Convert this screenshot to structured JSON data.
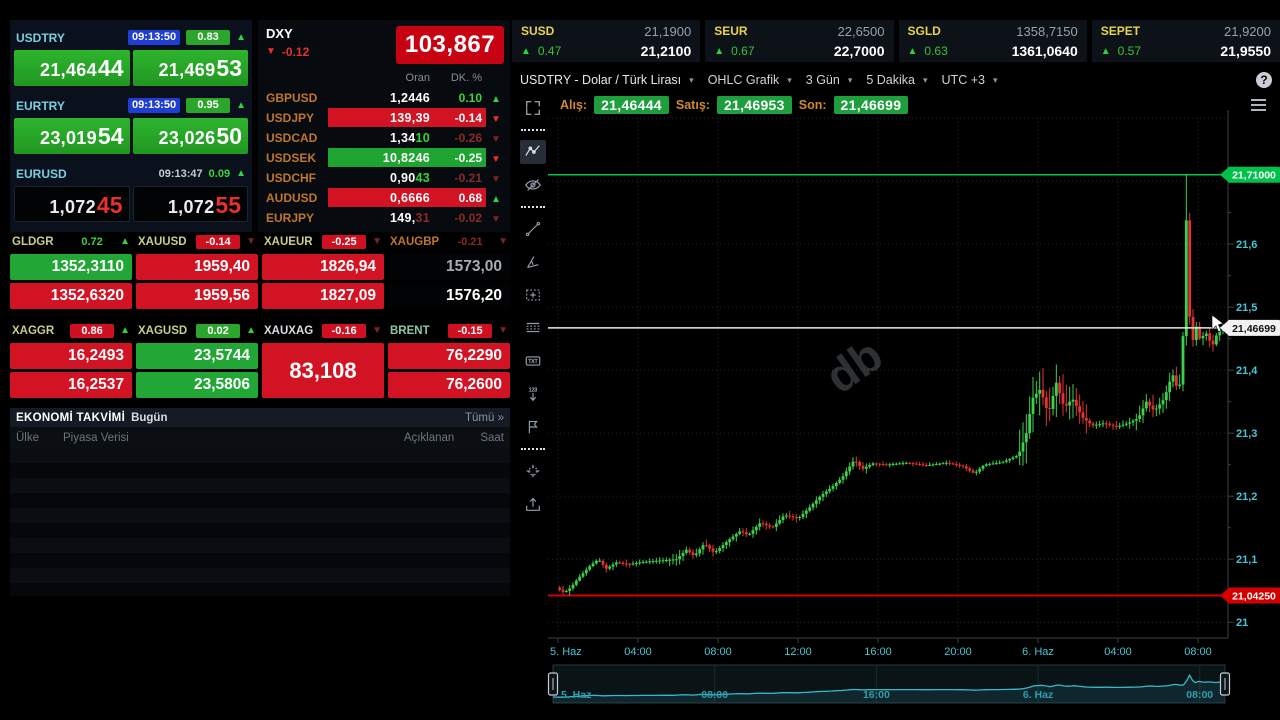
{
  "topbar": {
    "items": [
      {
        "label": "SUSD",
        "prev": "21,1900",
        "pct": "0.47",
        "value": "21,2100",
        "dir": "up"
      },
      {
        "label": "SEUR",
        "prev": "22,6500",
        "pct": "0.67",
        "value": "22,7000",
        "dir": "up"
      },
      {
        "label": "SGLD",
        "prev": "1358,7150",
        "pct": "0.63",
        "value": "1361,0640",
        "dir": "up"
      },
      {
        "label": "SEPET",
        "prev": "21,9200",
        "pct": "0.57",
        "value": "21,9550",
        "dir": "up"
      }
    ]
  },
  "quotes": [
    {
      "pair": "USDTRY",
      "time": "09:13:50",
      "time_badge": true,
      "pct": "0.83",
      "pct_badge": true,
      "dir": "up",
      "bid": [
        "21,464",
        "44"
      ],
      "ask": [
        "21,469",
        "53"
      ],
      "tile": "green"
    },
    {
      "pair": "EURTRY",
      "time": "09:13:50",
      "time_badge": true,
      "pct": "0.95",
      "pct_badge": true,
      "dir": "up",
      "bid": [
        "23,019",
        "54"
      ],
      "ask": [
        "23,026",
        "50"
      ],
      "tile": "green"
    },
    {
      "pair": "EURUSD",
      "time": "09:13:47",
      "time_badge": false,
      "pct": "0.09",
      "pct_badge": false,
      "dir": "up",
      "bid": [
        "1,072",
        "45"
      ],
      "ask": [
        "1,072",
        "55"
      ],
      "tile": "dark"
    }
  ],
  "dxy": {
    "label": "DXY",
    "pct": "-0.12",
    "dir": "down",
    "value": "103,867",
    "columns": {
      "rate": "Oran",
      "change": "DK. %"
    },
    "rows": [
      {
        "pair": "GBPUSD",
        "value": "1,2446",
        "hl": "",
        "hl_style": "",
        "pct": "0.10",
        "box": "none",
        "pct_color": "green",
        "arrow": "g"
      },
      {
        "pair": "USDJPY",
        "value": "139,39",
        "hl": "",
        "hl_style": "",
        "pct": "-0.14",
        "box": "red",
        "pct_color": "",
        "arrow": "r"
      },
      {
        "pair": "USDCAD",
        "value": "1,34",
        "hl": "10",
        "hl_style": "green",
        "pct": "-0.26",
        "box": "none",
        "pct_color": "dim",
        "arrow": "d"
      },
      {
        "pair": "USDSEK",
        "value": "10,8246",
        "hl": "",
        "hl_style": "",
        "pct": "-0.25",
        "box": "green",
        "pct_color": "",
        "arrow": "r"
      },
      {
        "pair": "USDCHF",
        "value": "0,90",
        "hl": "43",
        "hl_style": "green",
        "pct": "-0.21",
        "box": "none",
        "pct_color": "dim",
        "arrow": "d"
      },
      {
        "pair": "AUDUSD",
        "value": "0,6666",
        "hl": "",
        "hl_style": "",
        "pct": "0.68",
        "box": "red",
        "pct_color": "",
        "arrow": "g"
      },
      {
        "pair": "EURJPY",
        "value": "149,",
        "hl": "31",
        "hl_style": "dim",
        "pct": "-0.02",
        "box": "none",
        "pct_color": "dim",
        "arrow": "d"
      }
    ]
  },
  "commodities": {
    "row1": [
      {
        "label": "GLDGR",
        "label_color": "#c9cd8d",
        "pct": "0.72",
        "pct_style": "greent",
        "arrow": "g",
        "values": [
          {
            "text": "1352,3110",
            "bg": "green"
          },
          {
            "text": "1352,6320",
            "bg": "red"
          }
        ]
      },
      {
        "label": "XAUUSD",
        "label_color": "#c9cd8d",
        "pct": "-0.14",
        "pct_style": "redb",
        "arrow": "d",
        "values": [
          {
            "text": "1959,40",
            "bg": "red"
          },
          {
            "text": "1959,56",
            "bg": "red"
          }
        ]
      },
      {
        "label": "XAUEUR",
        "label_color": "#c9cd8d",
        "pct": "-0.25",
        "pct_style": "redb",
        "arrow": "d",
        "values": [
          {
            "text": "1826,94",
            "bg": "red"
          },
          {
            "text": "1827,09",
            "bg": "red"
          }
        ]
      },
      {
        "label": "XAUGBP",
        "label_color": "#c2752f",
        "pct": "-0.21",
        "pct_style": "dimt",
        "arrow": "d",
        "values": [
          {
            "text": "1573,00",
            "bg": "darkdim"
          },
          {
            "text": "1576,20",
            "bg": "dark"
          }
        ]
      }
    ],
    "row2": [
      {
        "label": "XAGGR",
        "label_color": "#c9cd8d",
        "pct": "0.86",
        "pct_style": "redb",
        "arrow": "g",
        "values": [
          {
            "text": "16,2493",
            "bg": "red"
          },
          {
            "text": "16,2537",
            "bg": "red"
          }
        ]
      },
      {
        "label": "XAGUSD",
        "label_color": "#c9cd8d",
        "pct": "0.02",
        "pct_style": "greenb",
        "arrow": "g",
        "values": [
          {
            "text": "23,5744",
            "bg": "green"
          },
          {
            "text": "23,5806",
            "bg": "green"
          }
        ]
      },
      {
        "label": "XAUXAG",
        "label_color": "#d9dde2",
        "pct": "-0.16",
        "pct_style": "redb",
        "arrow": "d",
        "values": [
          {
            "text": "83,108",
            "bg": "red",
            "tall": true
          }
        ]
      },
      {
        "label": "BRENT",
        "label_color": "#8bc7a6",
        "pct": "-0.15",
        "pct_style": "redb",
        "arrow": "d",
        "values": [
          {
            "text": "76,2290",
            "bg": "red"
          },
          {
            "text": "76,2600",
            "bg": "red"
          }
        ]
      }
    ]
  },
  "calendar": {
    "title": "EKONOMİ TAKVİMİ",
    "day": "Bugün",
    "all": "Tümü »",
    "col_country": "Ülke",
    "col_data": "Piyasa Verisi",
    "col_actual": "Açıklanan",
    "col_time": "Saat"
  },
  "chart": {
    "title": "USDTRY - Dolar / Türk Lirası",
    "chart_type": "OHLC Grafik",
    "range": "3 Gün",
    "interval": "5 Dakika",
    "timezone": "UTC +3",
    "bid_label": "Alış:",
    "bid": "21,46444",
    "ask_label": "Satış:",
    "ask": "21,46953",
    "last_label": "Son:",
    "last": "21,46699",
    "help_icon": "?",
    "watermark": "db",
    "y_labels": [
      "21,6",
      "21,5",
      "21,4",
      "21,3",
      "21,2",
      "21,1",
      "21"
    ],
    "x_labels": [
      "5. Haz",
      "04:00",
      "08:00",
      "12:00",
      "16:00",
      "20:00",
      "6. Haz",
      "04:00",
      "08:00"
    ],
    "nav_labels": [
      "5. Haz",
      "08:00",
      "16:00",
      "6. Haz",
      "08:00"
    ],
    "high_badge": "21,71000",
    "last_badge": "21,46699",
    "low_badge": "21,04250"
  },
  "chart_data": {
    "type": "ohlc-candlestick",
    "pair": "USDTRY",
    "title": "USDTRY - Dolar / Türk Lirası, 5 Dakika OHLC",
    "plotted_interval_minutes": 10,
    "time_axis_hours": [
      0,
      33.25
    ],
    "x_tick_hours": [
      0,
      4,
      8,
      12,
      16,
      20,
      24,
      28,
      32
    ],
    "nav_tick_hours": [
      0,
      8,
      16,
      24,
      32
    ],
    "ylim": [
      20.975,
      21.8
    ],
    "y_ticks": [
      21.6,
      21.5,
      21.4,
      21.3,
      21.2,
      21.1,
      21.0
    ],
    "high_line": 21.71,
    "low_line": 21.0425,
    "last_price": 21.46699,
    "low_touch_hour": 0.55,
    "high_touch_hour": 31.45,
    "waypoints": [
      [
        0,
        21.055
      ],
      [
        0.35,
        21.048
      ],
      [
        0.55,
        21.05
      ],
      [
        0.8,
        21.058
      ],
      [
        1.1,
        21.07
      ],
      [
        1.7,
        21.09
      ],
      [
        2.1,
        21.1
      ],
      [
        2.5,
        21.085
      ],
      [
        3,
        21.095
      ],
      [
        3.6,
        21.092
      ],
      [
        4.4,
        21.096
      ],
      [
        5.2,
        21.098
      ],
      [
        6,
        21.1
      ],
      [
        6.5,
        21.115
      ],
      [
        6.9,
        21.105
      ],
      [
        7.4,
        21.125
      ],
      [
        7.9,
        21.11
      ],
      [
        8.6,
        21.13
      ],
      [
        9.2,
        21.145
      ],
      [
        9.6,
        21.138
      ],
      [
        10.2,
        21.158
      ],
      [
        10.8,
        21.15
      ],
      [
        11.4,
        21.17
      ],
      [
        12.1,
        21.165
      ],
      [
        12.6,
        21.18
      ],
      [
        13.2,
        21.2
      ],
      [
        13.8,
        21.215
      ],
      [
        14.3,
        21.23
      ],
      [
        14.9,
        21.258
      ],
      [
        15.3,
        21.243
      ],
      [
        15.8,
        21.252
      ],
      [
        16.5,
        21.25
      ],
      [
        17.5,
        21.253
      ],
      [
        18.5,
        21.249
      ],
      [
        19.5,
        21.253
      ],
      [
        20.3,
        21.248
      ],
      [
        20.9,
        21.236
      ],
      [
        21.4,
        21.25
      ],
      [
        22.3,
        21.254
      ],
      [
        23.1,
        21.265
      ],
      [
        23.5,
        21.3
      ],
      [
        23.8,
        21.355
      ],
      [
        24.2,
        21.37
      ],
      [
        24.6,
        21.33
      ],
      [
        25,
        21.38
      ],
      [
        25.4,
        21.34
      ],
      [
        25.8,
        21.355
      ],
      [
        26.3,
        21.325
      ],
      [
        26.8,
        21.312
      ],
      [
        27.4,
        21.316
      ],
      [
        28,
        21.31
      ],
      [
        28.6,
        21.316
      ],
      [
        29.1,
        21.324
      ],
      [
        29.5,
        21.35
      ],
      [
        29.9,
        21.335
      ],
      [
        30.4,
        21.355
      ],
      [
        30.8,
        21.395
      ],
      [
        31.05,
        21.37
      ],
      [
        31.3,
        21.385
      ],
      [
        31.45,
        21.695
      ],
      [
        31.62,
        21.5
      ],
      [
        31.8,
        21.44
      ],
      [
        31.95,
        21.475
      ],
      [
        32.15,
        21.45
      ],
      [
        32.5,
        21.458
      ],
      [
        32.8,
        21.438
      ],
      [
        33,
        21.455
      ],
      [
        33.25,
        21.467
      ]
    ],
    "volatility": [
      [
        0,
        5.5,
        0.006
      ],
      [
        5.5,
        8.5,
        0.01
      ],
      [
        8.5,
        15.5,
        0.008
      ],
      [
        15.5,
        23,
        0.0045
      ],
      [
        23,
        26.5,
        0.035
      ],
      [
        26.5,
        28.8,
        0.008
      ],
      [
        28.8,
        31.2,
        0.018
      ],
      [
        31.2,
        31.75,
        0.015
      ],
      [
        31.75,
        33.3,
        0.012
      ]
    ],
    "colors": {
      "up": "#3ad14d",
      "down": "#e23531",
      "high_line": "#00c24a",
      "low_line": "#d40000",
      "last_line": "#e9e9e9",
      "axis_text": "#45c6d4",
      "grid": "#1f262e",
      "frame": "#3a424b",
      "nav_line": "#38b7c8",
      "nav_text": "#2f9fae",
      "watermark": "#848c96"
    }
  },
  "toolbar": {
    "active": "crosshair-trend",
    "icons": [
      "fullscreen",
      "crosshair-trend",
      "eye-off",
      "trend-line",
      "angle-tool",
      "select-box",
      "fib-lines",
      "text-tool",
      "price-note",
      "flag-tool",
      "magnet-tool",
      "export-tool"
    ]
  }
}
